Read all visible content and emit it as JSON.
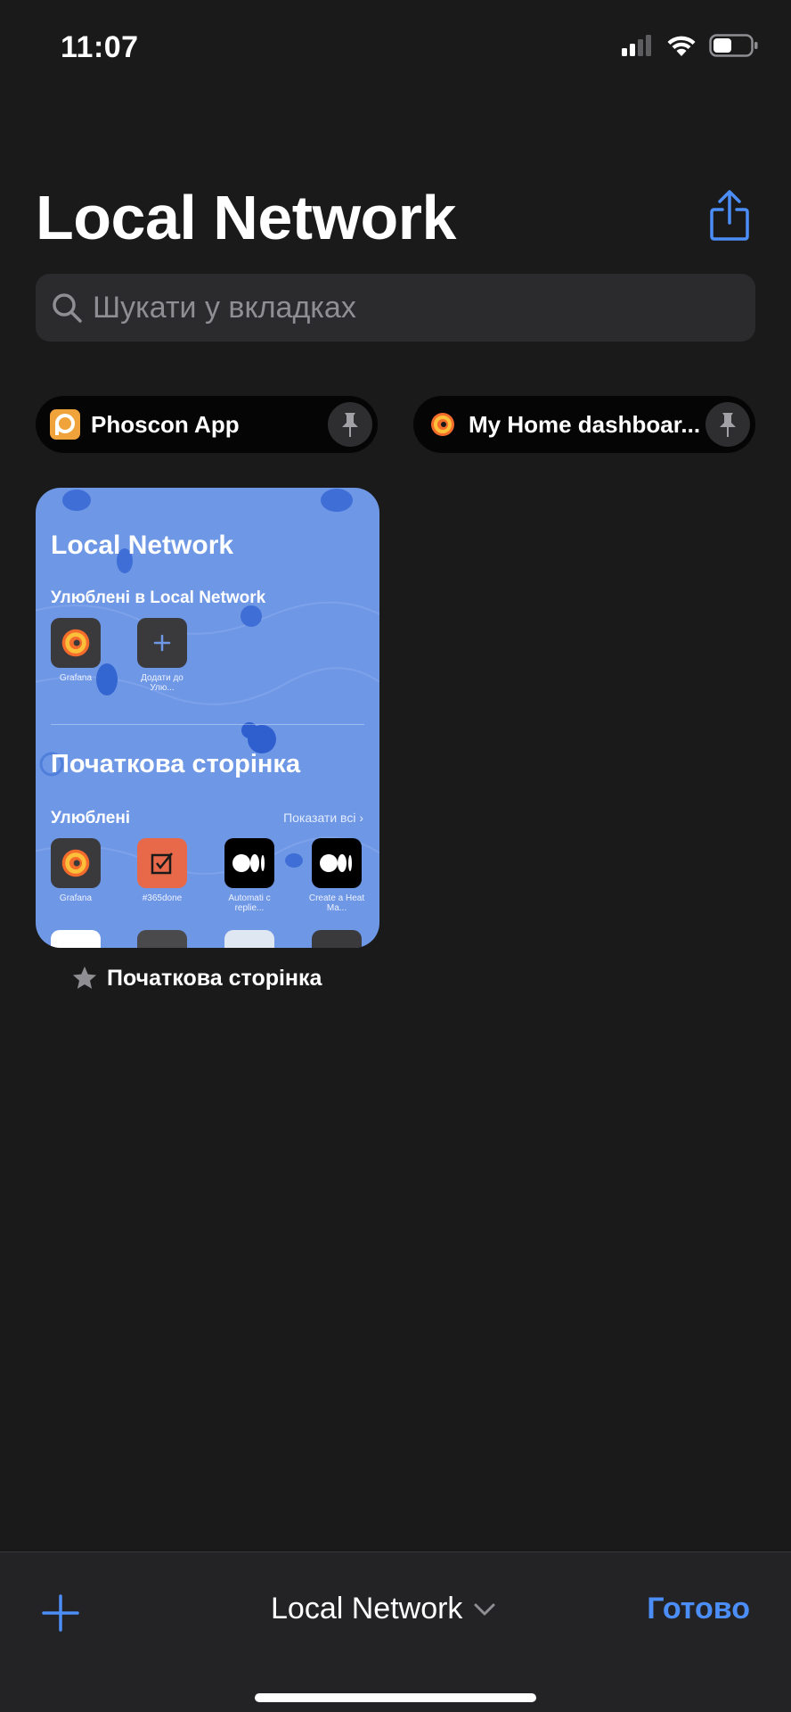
{
  "status_bar": {
    "time": "11:07"
  },
  "header": {
    "title": "Local Network"
  },
  "search": {
    "placeholder": "Шукати у вкладках"
  },
  "pinned_tabs": [
    {
      "label": "Phoscon App",
      "icon": "phoscon-icon"
    },
    {
      "label": "My Home dashboar...",
      "icon": "grafana-icon"
    }
  ],
  "tab_card": {
    "preview": {
      "title": "Local Network",
      "favorites_heading": "Улюблені в Local Network",
      "favorites": [
        {
          "caption": "Grafana",
          "icon": "grafana-icon"
        },
        {
          "caption": "Додати до Улю...",
          "icon": "plus-icon"
        }
      ],
      "start_page_title": "Початкова сторінка",
      "favorites_label": "Улюблені",
      "show_all": "Показати всі",
      "home_favorites": [
        {
          "caption": "Grafana",
          "icon": "grafana-icon"
        },
        {
          "caption": "#365done",
          "icon": "checkbox-icon"
        },
        {
          "caption": "Automati c replie...",
          "icon": "medium-icon"
        },
        {
          "caption": "Create a Heat Ma...",
          "icon": "medium-icon"
        }
      ]
    },
    "caption": "Початкова сторінка"
  },
  "bottom_bar": {
    "group_name": "Local Network",
    "done_label": "Готово"
  },
  "colors": {
    "background": "#1a1a1b",
    "accent": "#4c8ef7",
    "card_background": "#6e97e6",
    "search_background": "#2b2b2e"
  }
}
